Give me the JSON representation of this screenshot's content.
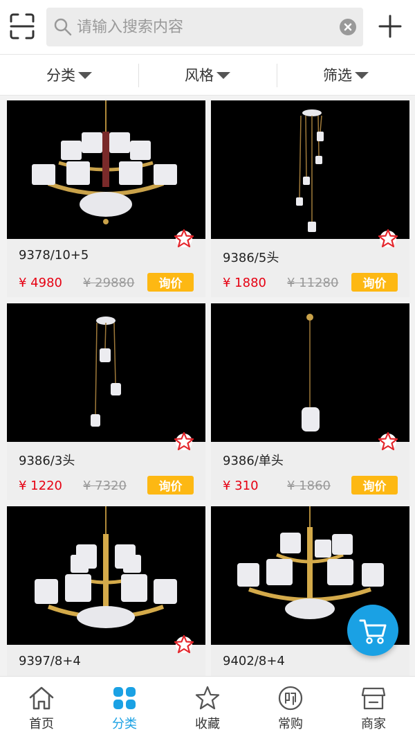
{
  "search": {
    "placeholder": "请输入搜索内容",
    "value": ""
  },
  "filters": [
    {
      "label": "分类"
    },
    {
      "label": "风格"
    },
    {
      "label": "筛选"
    }
  ],
  "products": [
    {
      "code": "9378/10+5",
      "price": "¥ 4980",
      "original_price": "¥ 29880",
      "ask_label": "询价"
    },
    {
      "code": "9386/5头",
      "price": "¥ 1880",
      "original_price": "¥ 11280",
      "ask_label": "询价"
    },
    {
      "code": "9386/3头",
      "price": "¥ 1220",
      "original_price": "¥ 7320",
      "ask_label": "询价"
    },
    {
      "code": "9386/单头",
      "price": "¥ 310",
      "original_price": "¥ 1860",
      "ask_label": "询价"
    },
    {
      "code": "9397/8+4",
      "price": "",
      "original_price": "",
      "ask_label": ""
    },
    {
      "code": "9402/8+4",
      "price": "",
      "original_price": "",
      "ask_label": ""
    }
  ],
  "tabs": [
    {
      "label": "首页",
      "icon": "home-icon"
    },
    {
      "label": "分类",
      "icon": "category-grid-icon",
      "active": true
    },
    {
      "label": "收藏",
      "icon": "star-icon"
    },
    {
      "label": "常购",
      "icon": "buy-badge-icon"
    },
    {
      "label": "商家",
      "icon": "store-icon"
    }
  ],
  "colors": {
    "accent": "#1aa1e4",
    "price": "#e60012",
    "ask_button": "#fdb813"
  }
}
